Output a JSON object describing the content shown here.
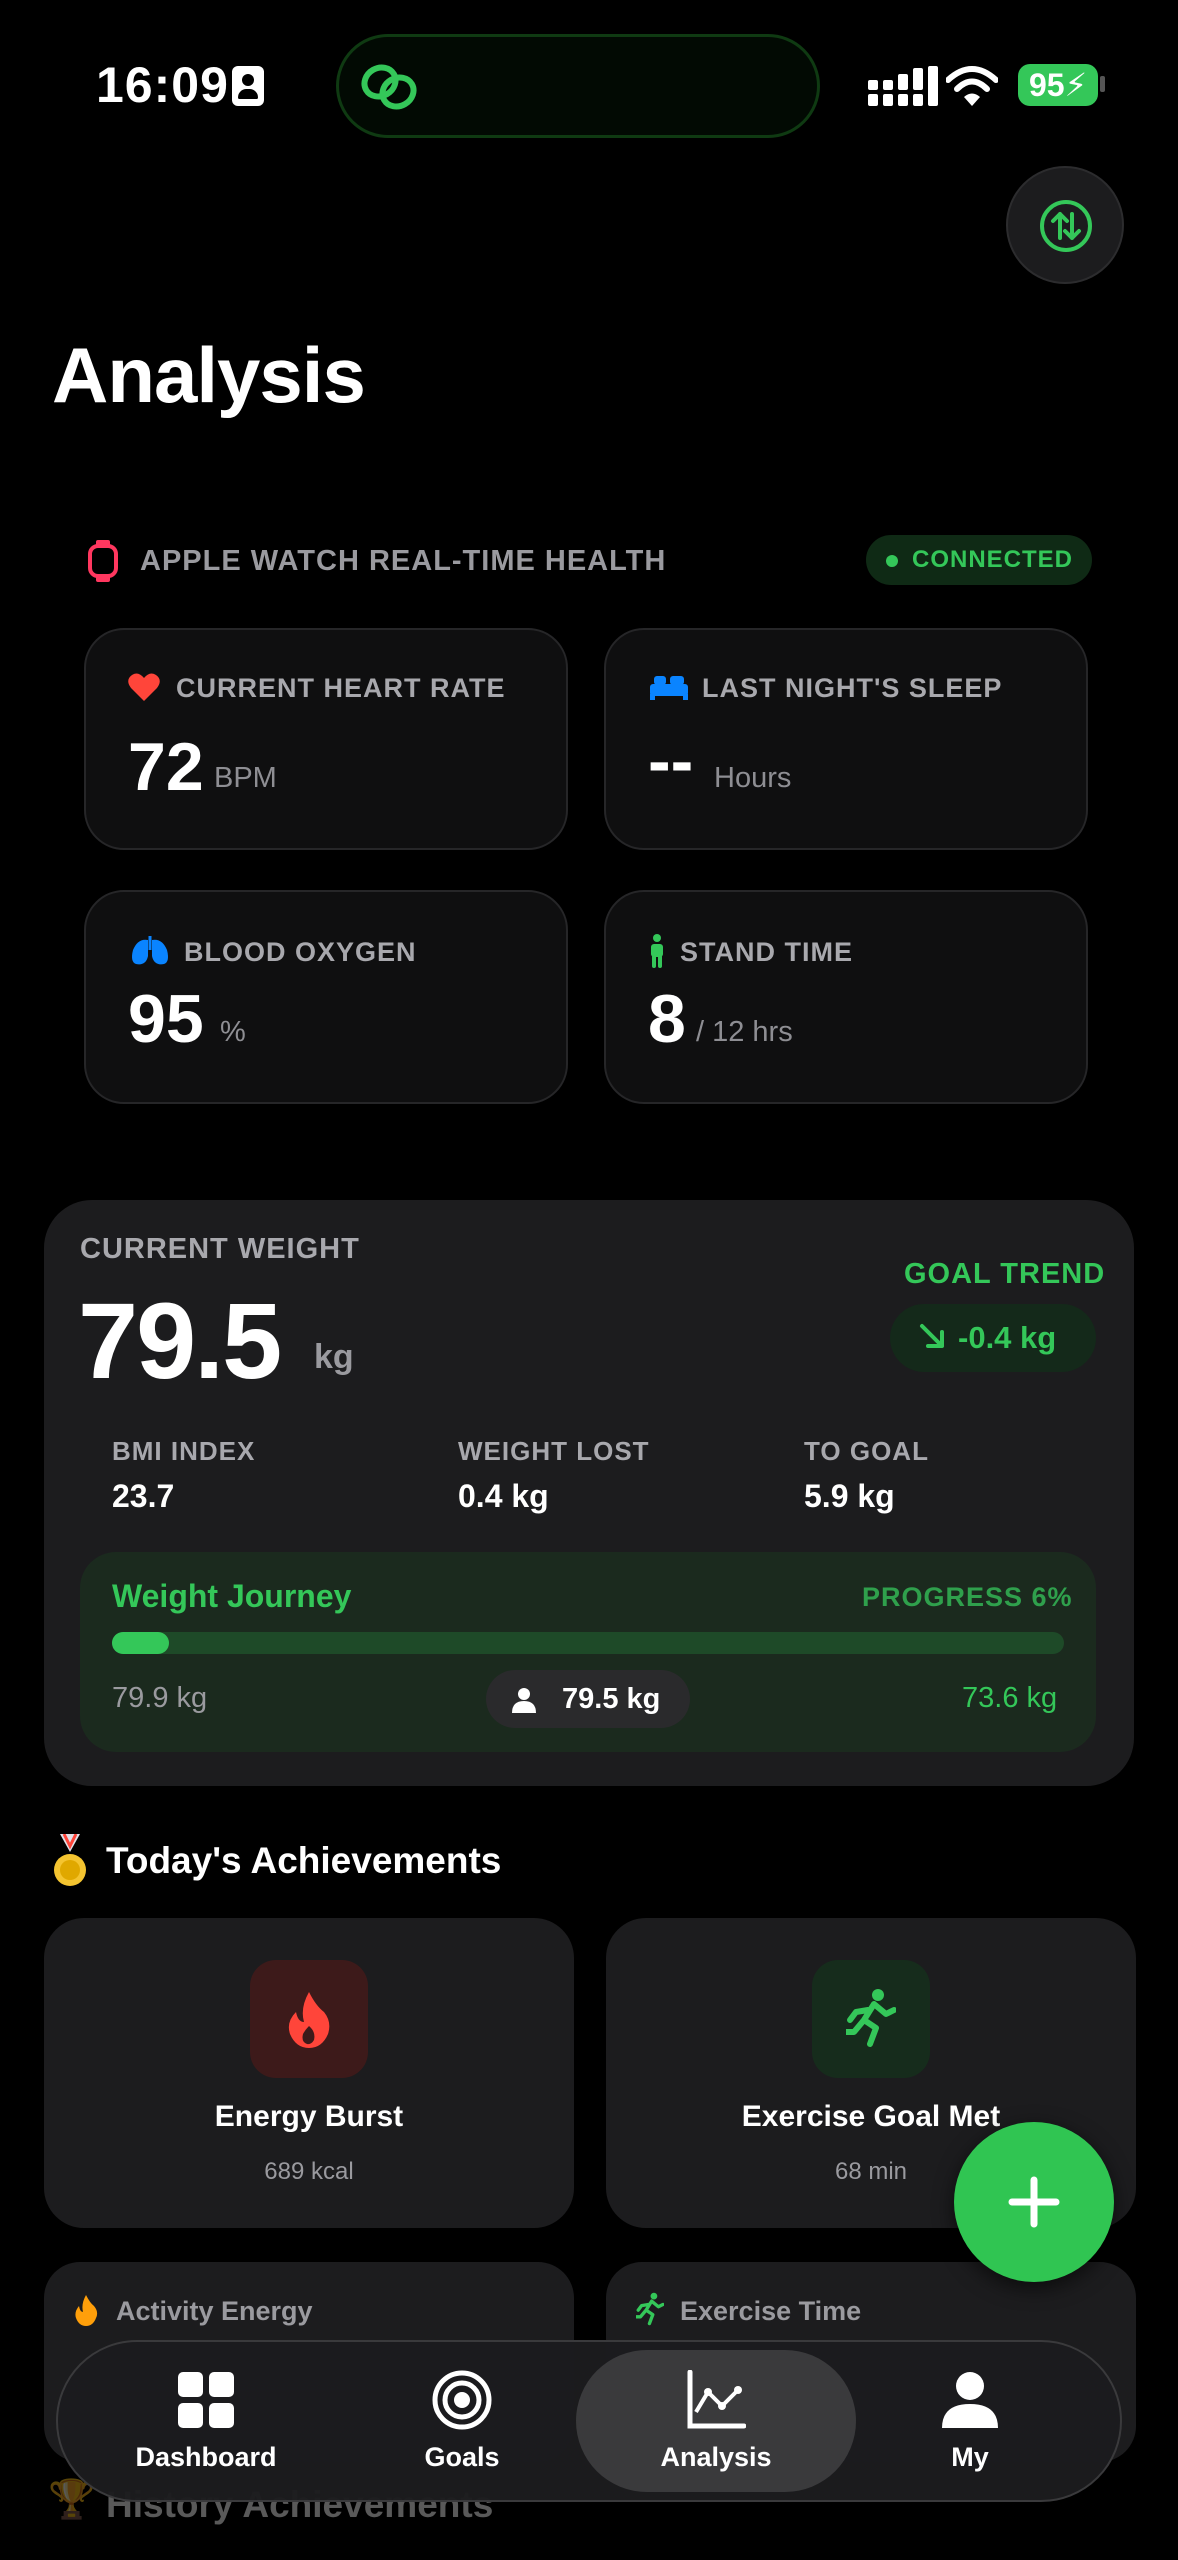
{
  "status_bar": {
    "time": "16:09",
    "battery": "95"
  },
  "page": {
    "title": "Analysis"
  },
  "watch": {
    "section_title": "APPLE WATCH REAL-TIME HEALTH",
    "status": "CONNECTED",
    "tiles": [
      {
        "label": "CURRENT HEART RATE",
        "value": "72",
        "unit": "BPM",
        "icon": "heart-icon"
      },
      {
        "label": "LAST NIGHT'S SLEEP",
        "value": "--",
        "unit": "Hours",
        "icon": "bed-icon"
      },
      {
        "label": "BLOOD OXYGEN",
        "value": "95",
        "unit": "%",
        "icon": "lungs-icon"
      },
      {
        "label": "STAND TIME",
        "value": "8",
        "unit": "/ 12 hrs",
        "icon": "standing-person-icon"
      }
    ]
  },
  "weight": {
    "label": "CURRENT WEIGHT",
    "value": "79.5",
    "unit": "kg",
    "goal_trend_label": "GOAL TREND",
    "goal_trend_value": "-0.4 kg",
    "stats": [
      {
        "label": "BMI INDEX",
        "value": "23.7"
      },
      {
        "label": "WEIGHT LOST",
        "value": "0.4 kg"
      },
      {
        "label": "TO GOAL",
        "value": "5.9 kg"
      }
    ],
    "journey": {
      "title": "Weight Journey",
      "progress_label": "PROGRESS 6%",
      "progress": 0.06,
      "start": "79.9 kg",
      "current": "79.5 kg",
      "goal": "73.6 kg"
    }
  },
  "achievements": {
    "title": "Today's Achievements",
    "cards": [
      {
        "name": "Energy Burst",
        "detail": "689 kcal",
        "icon": "flame-icon",
        "color": "#ff453a"
      },
      {
        "name": "Exercise Goal Met",
        "detail": "68 min",
        "icon": "running-icon",
        "color": "#34c759"
      }
    ],
    "mini": [
      {
        "label": "Activity Energy",
        "icon": "flame-icon"
      },
      {
        "label": "Exercise Time",
        "icon": "running-icon"
      }
    ],
    "history_title": "History Achievements"
  },
  "tabs": [
    {
      "label": "Dashboard",
      "icon": "grid-icon"
    },
    {
      "label": "Goals",
      "icon": "target-icon"
    },
    {
      "label": "Analysis",
      "icon": "chart-icon",
      "active": true
    },
    {
      "label": "My",
      "icon": "person-icon"
    }
  ],
  "colors": {
    "accent": "#34c759",
    "danger": "#ff453a",
    "card": "#1c1c1e",
    "background": "#000000"
  }
}
